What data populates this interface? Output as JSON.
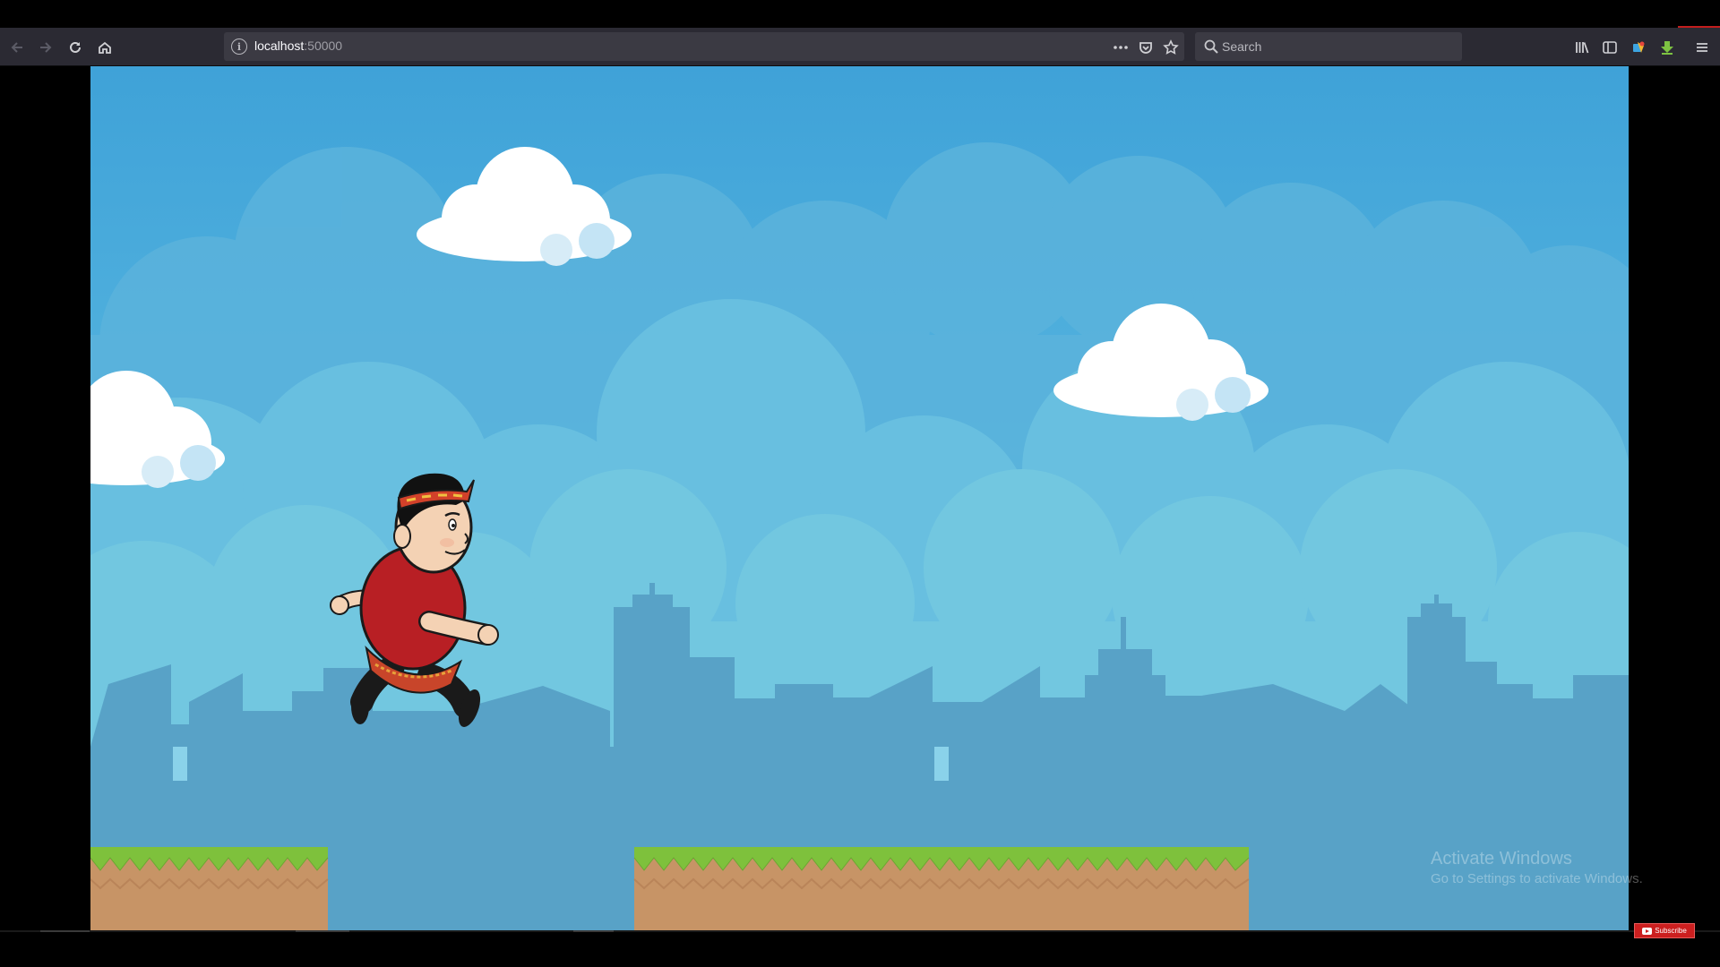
{
  "browser": {
    "url_host": "localhost",
    "url_port": ":50000",
    "search_placeholder": "Search"
  },
  "icons": {
    "back": "back-arrow-icon",
    "forward": "forward-arrow-icon",
    "reload": "reload-icon",
    "home": "home-icon",
    "page_info": "info-icon",
    "page_actions": "more-dots-icon",
    "pocket": "pocket-icon",
    "bookmark": "star-icon",
    "search": "search-icon",
    "library": "library-icon",
    "sidebar": "sidebar-icon",
    "extension": "extension-icon",
    "download": "download-icon",
    "menu": "hamburger-menu-icon"
  },
  "game": {
    "player": "runner-character",
    "platforms_count": 2
  },
  "overlay": {
    "watermark_line1": "Activate Windows",
    "watermark_line2": "Go to Settings to activate Windows.",
    "subscribe_label": "Subscribe"
  },
  "colors": {
    "sky_top": "#3fa2d8",
    "sky_bottom": "#6cc9e2",
    "city": "#5aa3c8",
    "grass": "#7ec13c",
    "dirt": "#c79466",
    "shirt": "#b81f24"
  }
}
